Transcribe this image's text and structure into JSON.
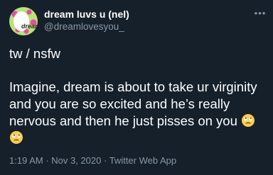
{
  "tweet": {
    "author": {
      "display_name": "dream luvs u (nel)",
      "handle": "@dreamlovesyou_",
      "avatar_text": "dream"
    },
    "more_icon": "more-horizontal-icon",
    "text_line_1": "tw / nsfw",
    "text_line_2": "Imagine, dream is about to take ur virginity and you are so excited and he’s really nervous and then he just pisses on you",
    "emojis": [
      "face-with-rolling-eyes-emoji",
      "face-with-rolling-eyes-emoji"
    ],
    "time": "1:19 AM",
    "date": "Nov 3, 2020",
    "source": "Twitter Web App",
    "separator": " · "
  },
  "colors": {
    "background": "#15202b",
    "text": "#ffffff",
    "secondary": "#8899a6"
  }
}
